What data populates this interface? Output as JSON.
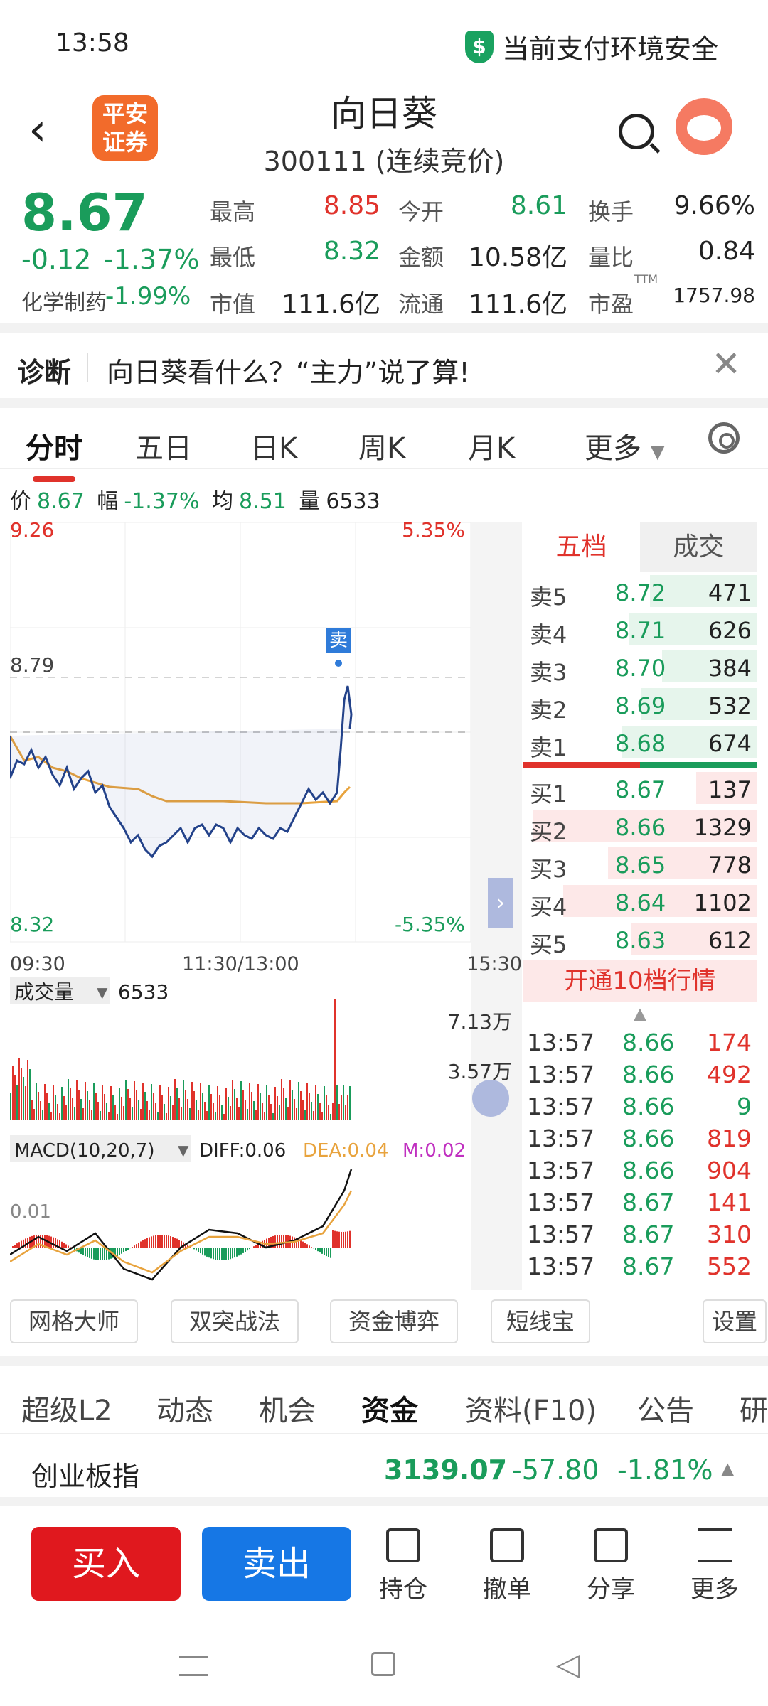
{
  "status": {
    "time": "13:58",
    "safe_text": "当前支付环境安全",
    "shield_glyph": "$"
  },
  "header": {
    "title": "向日葵",
    "subtitle": "300111 (连续竞价)",
    "logo_text": "平安\n证券"
  },
  "quote": {
    "price": "8.67",
    "change": "-0.12",
    "change_pct": "-1.37%",
    "industry": "化学制药",
    "industry_pct": "-1.99%",
    "cells": [
      {
        "label": "最高",
        "value": "8.85",
        "color": "#e0322b"
      },
      {
        "label": "今开",
        "value": "8.61",
        "color": "#1a9c5b"
      },
      {
        "label": "换手",
        "value": "9.66%",
        "color": "#222"
      },
      {
        "label": "最低",
        "value": "8.32",
        "color": "#1a9c5b"
      },
      {
        "label": "金额",
        "value": "10.58亿",
        "color": "#222"
      },
      {
        "label": "量比",
        "value": "0.84",
        "color": "#222"
      },
      {
        "label": "市值",
        "value": "111.6亿",
        "color": "#222"
      },
      {
        "label": "流通",
        "value": "111.6亿",
        "color": "#222"
      },
      {
        "label": "市盈",
        "value": "1757.98",
        "color": "#222"
      }
    ],
    "ttm": "TTM"
  },
  "diagnosis": {
    "label": "诊断",
    "message": "向日葵看什么？“主力”说了算!"
  },
  "tabs": [
    "分时",
    "五日",
    "日K",
    "周K",
    "月K",
    "更多"
  ],
  "info": {
    "price_label": "价",
    "price": "8.67",
    "range_label": "幅",
    "range": "-1.37%",
    "avg_label": "均",
    "avg": "8.51",
    "vol_label": "量",
    "vol": "6533"
  },
  "chart": {
    "y_top": "9.26",
    "y_top_pct": "5.35%",
    "y_mid": "8.79",
    "y_bottom": "8.32",
    "y_bottom_pct": "-5.35%",
    "x_labels": [
      "09:30",
      "11:30/13:00",
      "15:30"
    ],
    "sell_marker": "卖",
    "vol_label": "成交量",
    "vol_value": "6533",
    "vol_max": "7.13万",
    "vol_mid": "3.57万",
    "macd_label": "MACD(10,20,7)",
    "diff": "DIFF:0.06",
    "dea": "DEA:0.04",
    "m": "M:0.02",
    "macd_tick": "0.01"
  },
  "orderbook": {
    "tabs": [
      "五档",
      "成交"
    ],
    "sells": [
      {
        "name": "卖5",
        "price": "8.72",
        "vol": "471"
      },
      {
        "name": "卖4",
        "price": "8.71",
        "vol": "626"
      },
      {
        "name": "卖3",
        "price": "8.70",
        "vol": "384"
      },
      {
        "name": "卖2",
        "price": "8.69",
        "vol": "532"
      },
      {
        "name": "卖1",
        "price": "8.68",
        "vol": "674"
      }
    ],
    "buys": [
      {
        "name": "买1",
        "price": "8.67",
        "vol": "137"
      },
      {
        "name": "买2",
        "price": "8.66",
        "vol": "1329"
      },
      {
        "name": "买3",
        "price": "8.65",
        "vol": "778"
      },
      {
        "name": "买4",
        "price": "8.64",
        "vol": "1102"
      },
      {
        "name": "买5",
        "price": "8.63",
        "vol": "612"
      }
    ],
    "open10": "开通10档行情"
  },
  "ticks": [
    {
      "time": "13:57",
      "price": "8.66",
      "vol": "174"
    },
    {
      "time": "13:57",
      "price": "8.66",
      "vol": "492"
    },
    {
      "time": "13:57",
      "price": "8.66",
      "vol": "9"
    },
    {
      "time": "13:57",
      "price": "8.66",
      "vol": "819"
    },
    {
      "time": "13:57",
      "price": "8.66",
      "vol": "904"
    },
    {
      "time": "13:57",
      "price": "8.67",
      "vol": "141"
    },
    {
      "time": "13:57",
      "price": "8.67",
      "vol": "310"
    },
    {
      "time": "13:57",
      "price": "8.67",
      "vol": "552"
    }
  ],
  "tools": [
    "网格大师",
    "双突战法",
    "资金博弈",
    "短线宝",
    "设置"
  ],
  "lower_tabs": [
    "超级L2",
    "动态",
    "机会",
    "资金",
    "资料(F10)",
    "公告",
    "研"
  ],
  "index": {
    "name": "创业板指",
    "value": "3139.07",
    "change": "-57.80",
    "pct": "-1.81%"
  },
  "bottom": {
    "buy": "买入",
    "sell": "卖出",
    "icons": [
      "持仓",
      "撤单",
      "分享",
      "更多"
    ]
  }
}
